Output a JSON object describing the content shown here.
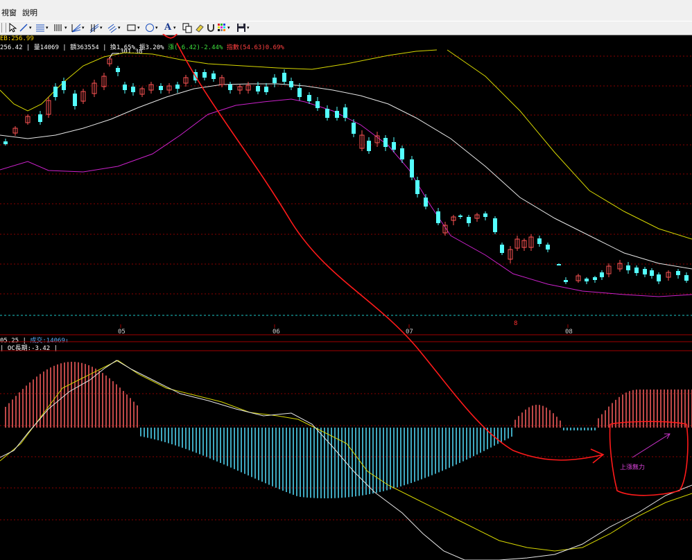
{
  "menu": {
    "items": [
      "視窗",
      "說明"
    ]
  },
  "toolbar": {
    "icons": [
      "drag-handle-icon",
      "select-arrow-icon",
      "line-tool-icon",
      "multi-line-tool-icon",
      "vertical-lines-icon",
      "fan-lines-icon",
      "channel-lines-icon",
      "parallel-lines-icon",
      "rectangle-tool-icon",
      "ellipse-tool-icon",
      "text-tool-icon",
      "copy-icon",
      "eraser-icon",
      "magnet-icon",
      "color-palette-icon",
      "save-icon"
    ],
    "text_tool_glyph": "A"
  },
  "price_panel": {
    "ma_label": "EB:256.99",
    "stats": {
      "close": "256.42",
      "volume": "量14069",
      "amount": "額363554",
      "turnover": "換1.65%",
      "amplitude": "振3.20%",
      "change": "漲(-6.42)-2.44%",
      "index": "指數(54.63)0.69%"
    },
    "high_label": "301.38"
  },
  "month_labels": [
    "05",
    "06",
    "07",
    "08"
  ],
  "period_marker": "8",
  "volume_panel": {
    "label_prefix": "05.25",
    "label_value": "成交:14069"
  },
  "macd_panel": {
    "label": "OC長期:-3.42"
  },
  "annotation": {
    "text": "上漲無力"
  },
  "colors": {
    "up": "#ff5454",
    "down": "#54ffff",
    "grid": "#8b0000",
    "upper_band": "#d8d800",
    "middle_band": "#e8e8e8",
    "lower_band": "#cc22cc",
    "macd_up": "#ff6060",
    "macd_down": "#54e0ff",
    "annotation": "#ff1a1a",
    "arrow": "#cc33cc"
  }
}
